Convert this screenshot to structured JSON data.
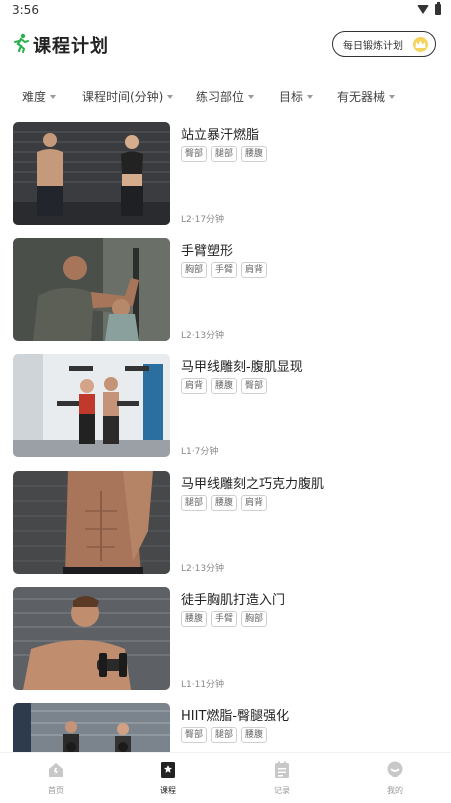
{
  "status_bar": {
    "time": "3:56"
  },
  "header": {
    "title": "课程计划",
    "plan_button_label": "每日锻炼计划"
  },
  "filters": [
    {
      "label": "难度"
    },
    {
      "label": "课程时间(分钟)"
    },
    {
      "label": "练习部位"
    },
    {
      "label": "目标"
    },
    {
      "label": "有无器械"
    }
  ],
  "courses": [
    {
      "title": "站立暴汗燃脂",
      "tags": [
        "臀部",
        "腿部",
        "腰腹"
      ],
      "meta": "L2·17分钟"
    },
    {
      "title": "手臂塑形",
      "tags": [
        "胸部",
        "手臂",
        "肩背"
      ],
      "meta": "L2·13分钟"
    },
    {
      "title": "马甲线雕刻-腹肌显现",
      "tags": [
        "肩背",
        "腰腹",
        "臀部"
      ],
      "meta": "L1·7分钟"
    },
    {
      "title": "马甲线雕刻之巧克力腹肌",
      "tags": [
        "腿部",
        "腰腹",
        "肩背"
      ],
      "meta": "L2·13分钟"
    },
    {
      "title": "徒手胸肌打造入门",
      "tags": [
        "腰腹",
        "手臂",
        "胸部"
      ],
      "meta": "L1·11分钟"
    },
    {
      "title": "HIIT燃脂-臀腿强化",
      "tags": [
        "臀部",
        "腿部",
        "腰腹"
      ],
      "meta": ""
    }
  ],
  "bottom_nav": [
    {
      "label": "首页",
      "icon": "home-icon"
    },
    {
      "label": "课程",
      "icon": "course-icon",
      "active": true
    },
    {
      "label": "记录",
      "icon": "record-icon"
    },
    {
      "label": "我的",
      "icon": "profile-icon"
    }
  ],
  "colors": {
    "accent": "#2bb24c",
    "crown": "#f6d35b"
  }
}
